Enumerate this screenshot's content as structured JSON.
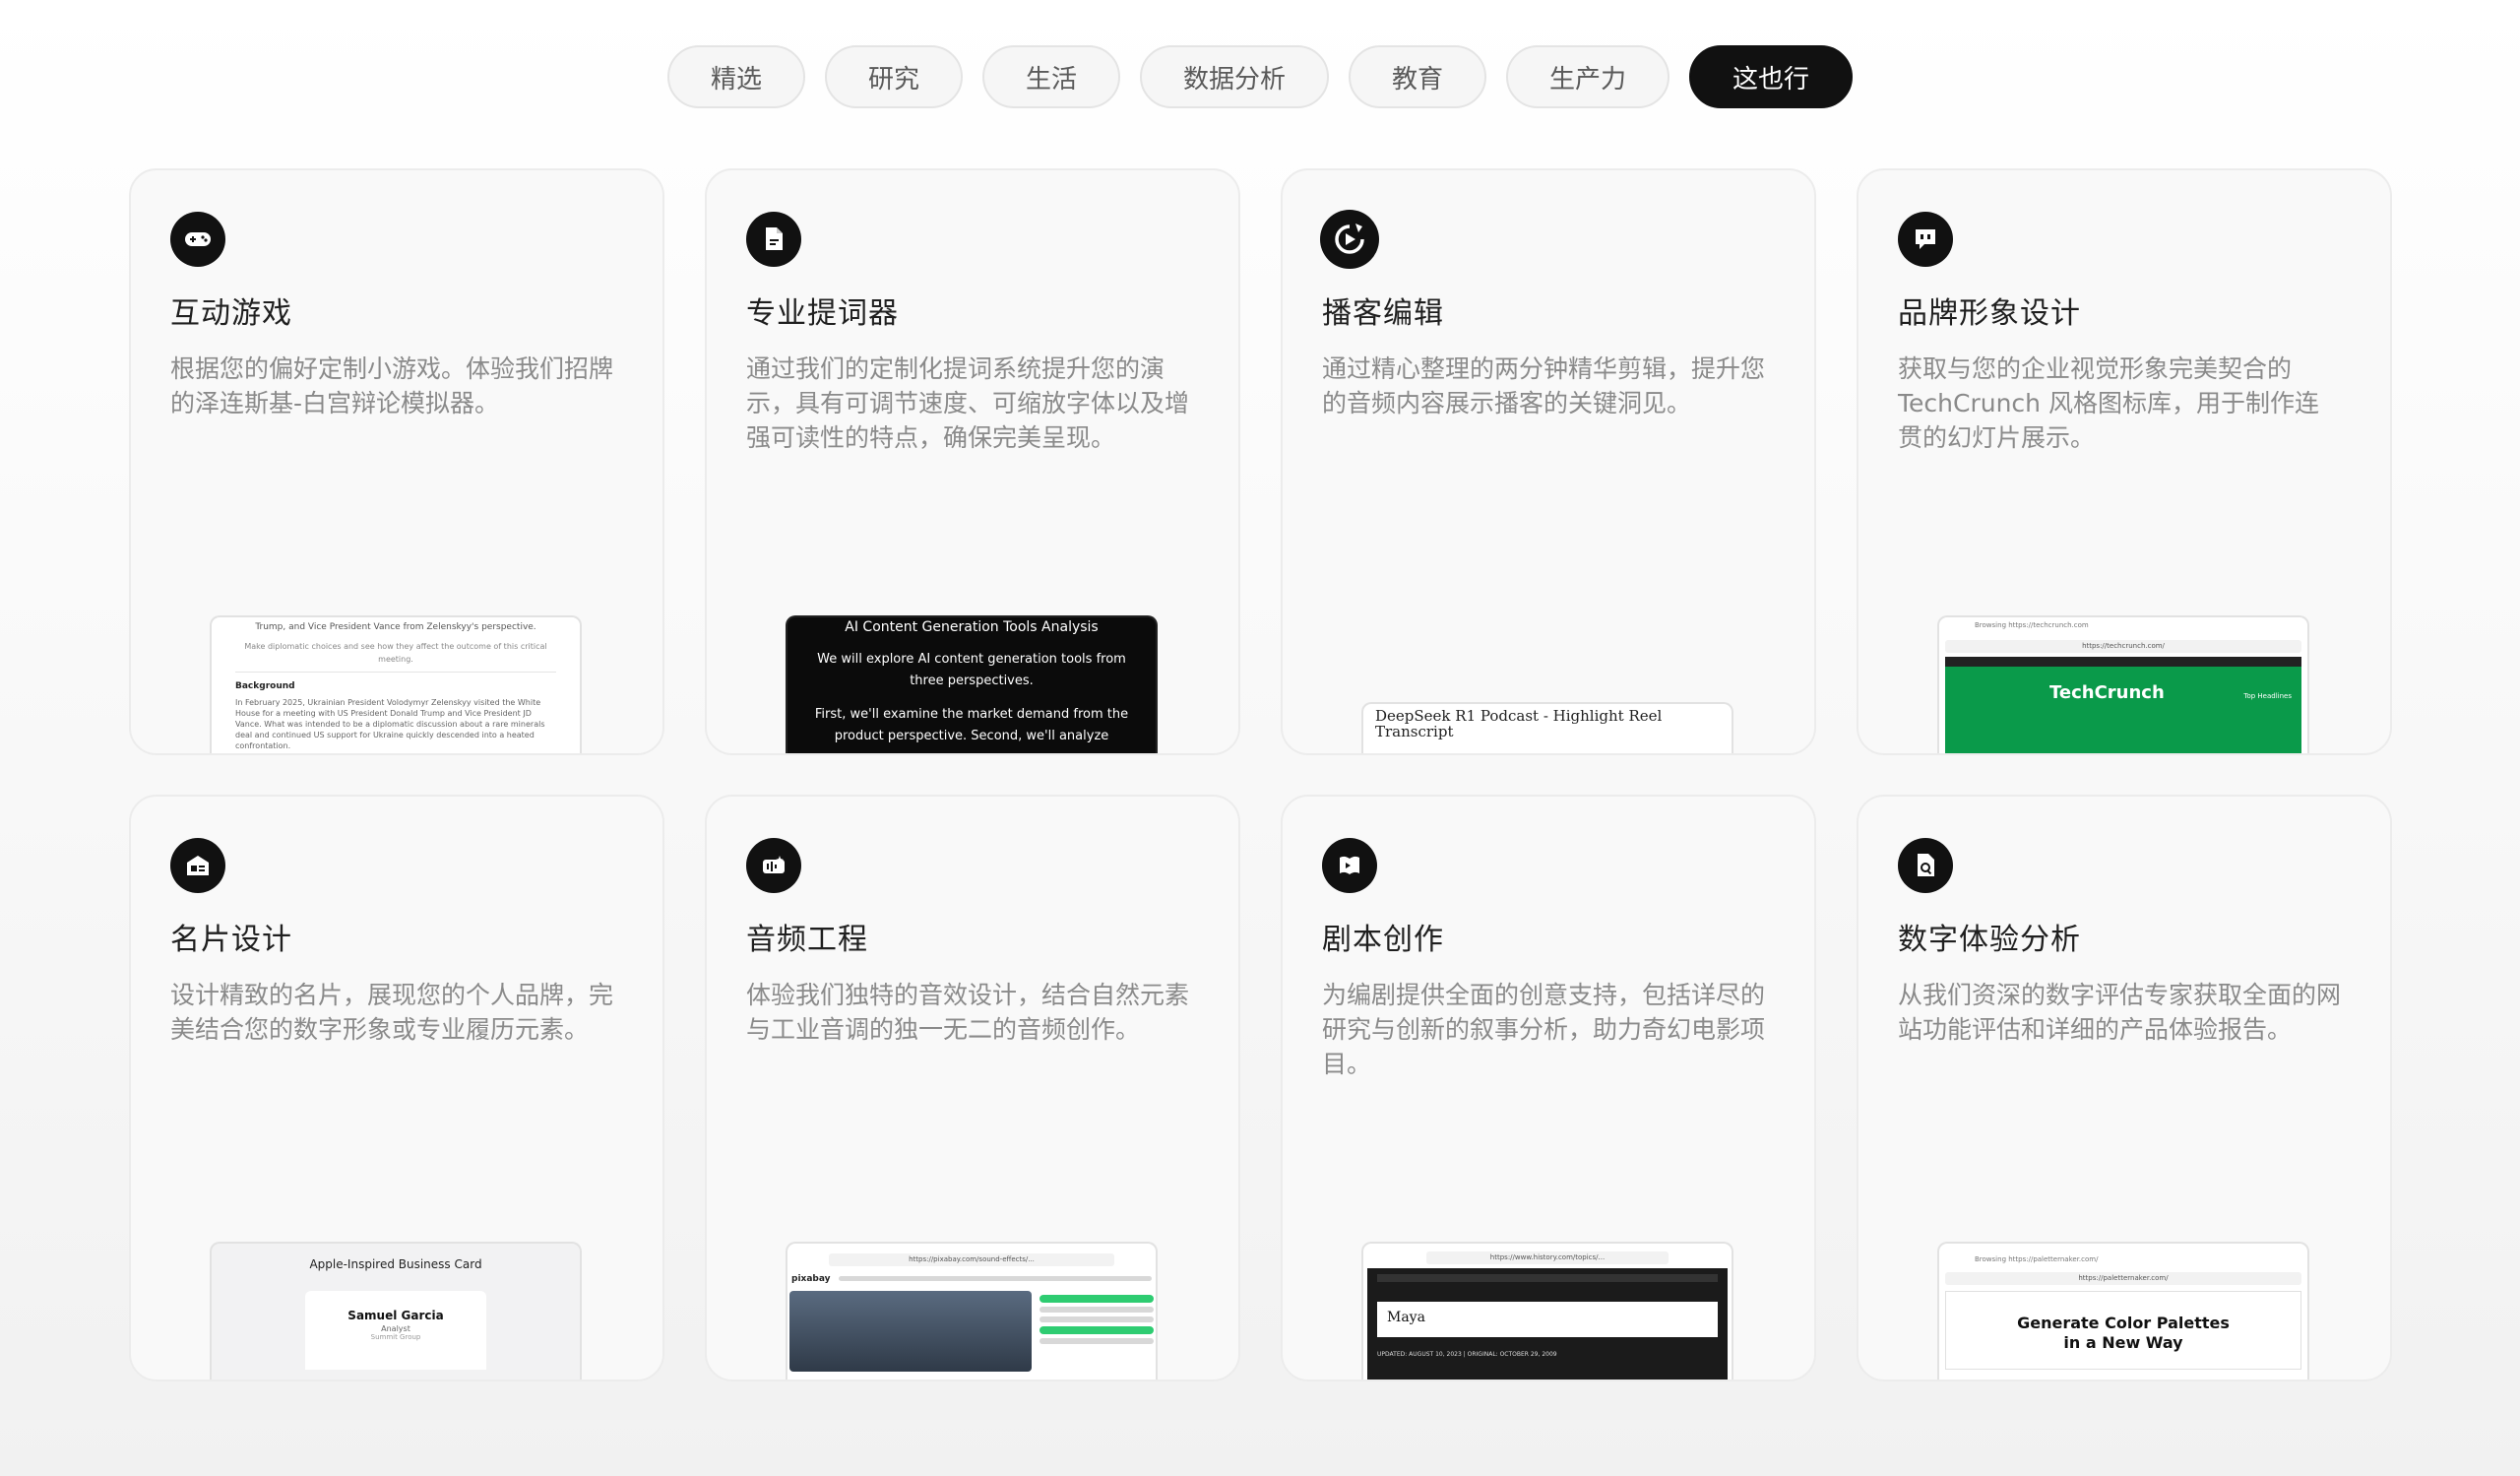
{
  "tabs": [
    {
      "label": "精选",
      "active": false
    },
    {
      "label": "研究",
      "active": false
    },
    {
      "label": "生活",
      "active": false
    },
    {
      "label": "数据分析",
      "active": false
    },
    {
      "label": "教育",
      "active": false
    },
    {
      "label": "生产力",
      "active": false
    },
    {
      "label": "这也行",
      "active": true
    }
  ],
  "cards": [
    {
      "icon": "gamepad-icon",
      "title": "互动游戏",
      "desc": "根据您的偏好定制小游戏。体验我们招牌的泽连斯基-白宫辩论模拟器。",
      "preview": {
        "line1": "Trump, and Vice President Vance from Zelenskyy's perspective.",
        "line2": "Make diplomatic choices and see how they affect the outcome of this critical meeting.",
        "heading": "Background",
        "body": "In February 2025, Ukrainian President Volodymyr Zelenskyy visited the White House for a meeting with US President Donald Trump and Vice President JD Vance. What was intended to be a diplomatic discussion about a rare minerals deal and continued US support for Ukraine quickly descended into a heated confrontation."
      }
    },
    {
      "icon": "document-pen-icon",
      "title": "专业提词器",
      "desc": "通过我们的定制化提词系统提升您的演示，具有可调节速度、可缩放字体以及增强可读性的特点，确保完美呈现。",
      "preview": {
        "title": "AI Content Generation Tools Analysis",
        "p1": "We will explore AI content generation tools from three perspectives.",
        "p2": "First, we'll examine the market demand from the product perspective. Second, we'll analyze"
      }
    },
    {
      "icon": "refresh-play-icon",
      "title": "播客编辑",
      "desc": "通过精心整理的两分钟精华剪辑，提升您的音频内容展示播客的关键洞见。",
      "preview": {
        "title": "DeepSeek R1 Podcast - Highlight Reel Transcript"
      }
    },
    {
      "icon": "chat-brand-icon",
      "title": "品牌形象设计",
      "desc": "获取与您的企业视觉形象完美契合的TechCrunch 风格图标库，用于制作连贯的幻灯片展示。",
      "preview": {
        "browsing": "Browsing https://techcrunch.com",
        "url": "https://techcrunch.com/",
        "logo": "TechCrunch",
        "side": "Top Headlines"
      }
    },
    {
      "icon": "business-card-icon",
      "title": "名片设计",
      "desc": "设计精致的名片，展现您的个人品牌，完美结合您的数字形象或专业履历元素。",
      "preview": {
        "title": "Apple-Inspired Business Card",
        "name": "Samuel Garcia",
        "role": "Analyst",
        "org": "Summit Group"
      }
    },
    {
      "icon": "audio-wave-icon",
      "title": "音频工程",
      "desc": "体验我们独特的音效设计，结合自然元素与工业音调的独一无二的音频创作。",
      "preview": {
        "url": "https://pixabay.com/sound-effects/...",
        "logo": "pixabay"
      }
    },
    {
      "icon": "script-book-icon",
      "title": "剧本创作",
      "desc": "为编剧提供全面的创意支持，包括详尽的研究与创新的叙事分析，助力奇幻电影项目。",
      "preview": {
        "url": "https://www.history.com/topics/...",
        "name": "Maya",
        "meta": "UPDATED: AUGUST 10, 2023 | ORIGINAL: OCTOBER 29, 2009"
      }
    },
    {
      "icon": "doc-search-icon",
      "title": "数字体验分析",
      "desc": "从我们资深的数字评估专家获取全面的网站功能评估和详细的产品体验报告。",
      "preview": {
        "browsing": "Browsing https://paletternaker.com/",
        "url": "https://paletternaker.com/",
        "headline1": "Generate Color Palettes",
        "headline2": "in a New Way"
      }
    }
  ]
}
